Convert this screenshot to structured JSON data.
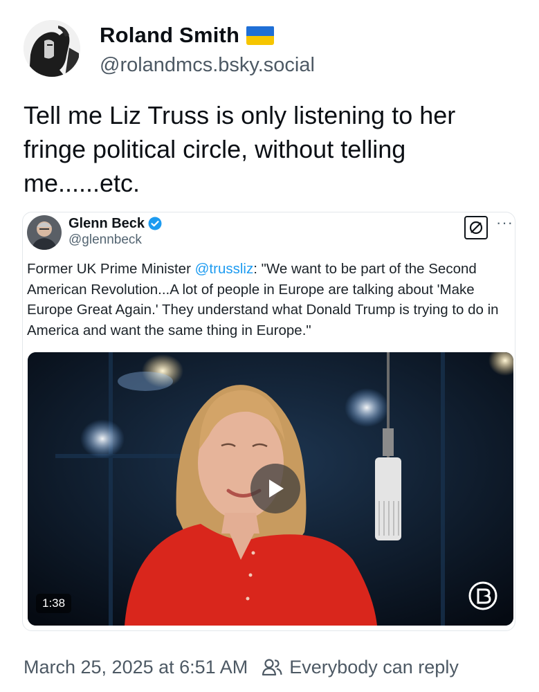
{
  "author": {
    "name": "Roland Smith",
    "handle": "@rolandmcs.bsky.social",
    "flag_icon": "ukraine-flag-icon"
  },
  "post": {
    "text": "Tell me Liz Truss is only listening to her fringe political circle, without telling me......etc."
  },
  "quoted_post": {
    "name": "Glenn Beck",
    "handle": "@glennbeck",
    "verified_icon": "verified-badge-icon",
    "text_before": "Former UK Prime Minister ",
    "mention": "@trussliz",
    "text_after": ": \"We want to be part of the Second American Revolution...A lot of people in Europe are talking about 'Make Europe Great Again.' They understand what Donald Trump is trying to do in America and want the same thing in Europe.\"",
    "video": {
      "duration": "1:38",
      "play_icon": "play-icon",
      "brand_icon": "blaze-logo-icon"
    }
  },
  "footer": {
    "timestamp": "March 25, 2025 at 6:51 AM",
    "reply_setting": "Everybody can reply",
    "reply_icon": "people-icon"
  },
  "colors": {
    "text": "#0b0f14",
    "muted": "#4d5964",
    "mention": "#1d9bf0",
    "shirt": "#d9261c"
  }
}
